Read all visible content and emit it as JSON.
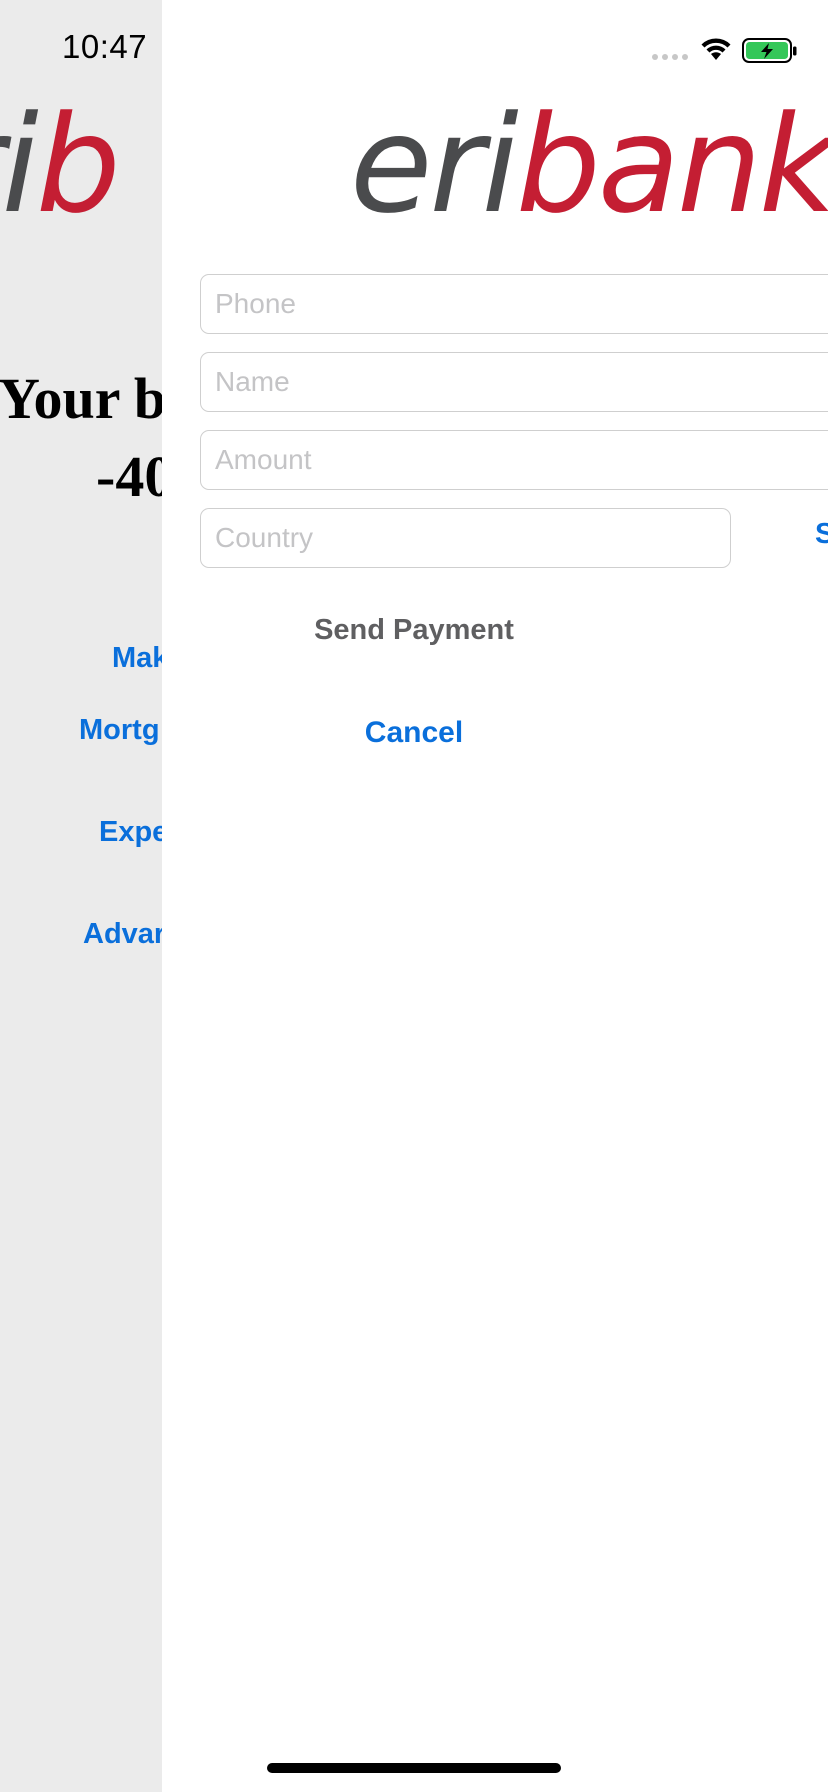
{
  "status_bar": {
    "time": "10:47"
  },
  "background_screen": {
    "logo": {
      "part1": "eri",
      "part2": "b"
    },
    "balance": {
      "line1": "Your b",
      "line2": "-40"
    },
    "links": [
      {
        "label": "Mak"
      },
      {
        "label": "Mortg"
      },
      {
        "label": "Expe"
      },
      {
        "label": "Advar"
      }
    ]
  },
  "sheet": {
    "logo": {
      "part1": "eri",
      "part2": "bank"
    },
    "fields": {
      "phone": {
        "placeholder": "Phone",
        "value": ""
      },
      "name": {
        "placeholder": "Name",
        "value": ""
      },
      "amount": {
        "placeholder": "Amount",
        "value": ""
      },
      "country": {
        "placeholder": "Country",
        "value": ""
      }
    },
    "select_label": "S",
    "send_button": "Send Payment",
    "cancel_button": "Cancel"
  },
  "colors": {
    "brand_gray": "#4a4b4d",
    "brand_red": "#c41e33",
    "link_blue": "#0a6fdb",
    "battery_green": "#34c759"
  },
  "icons": [
    "signal-icon",
    "wifi-icon",
    "battery-charging-icon"
  ]
}
